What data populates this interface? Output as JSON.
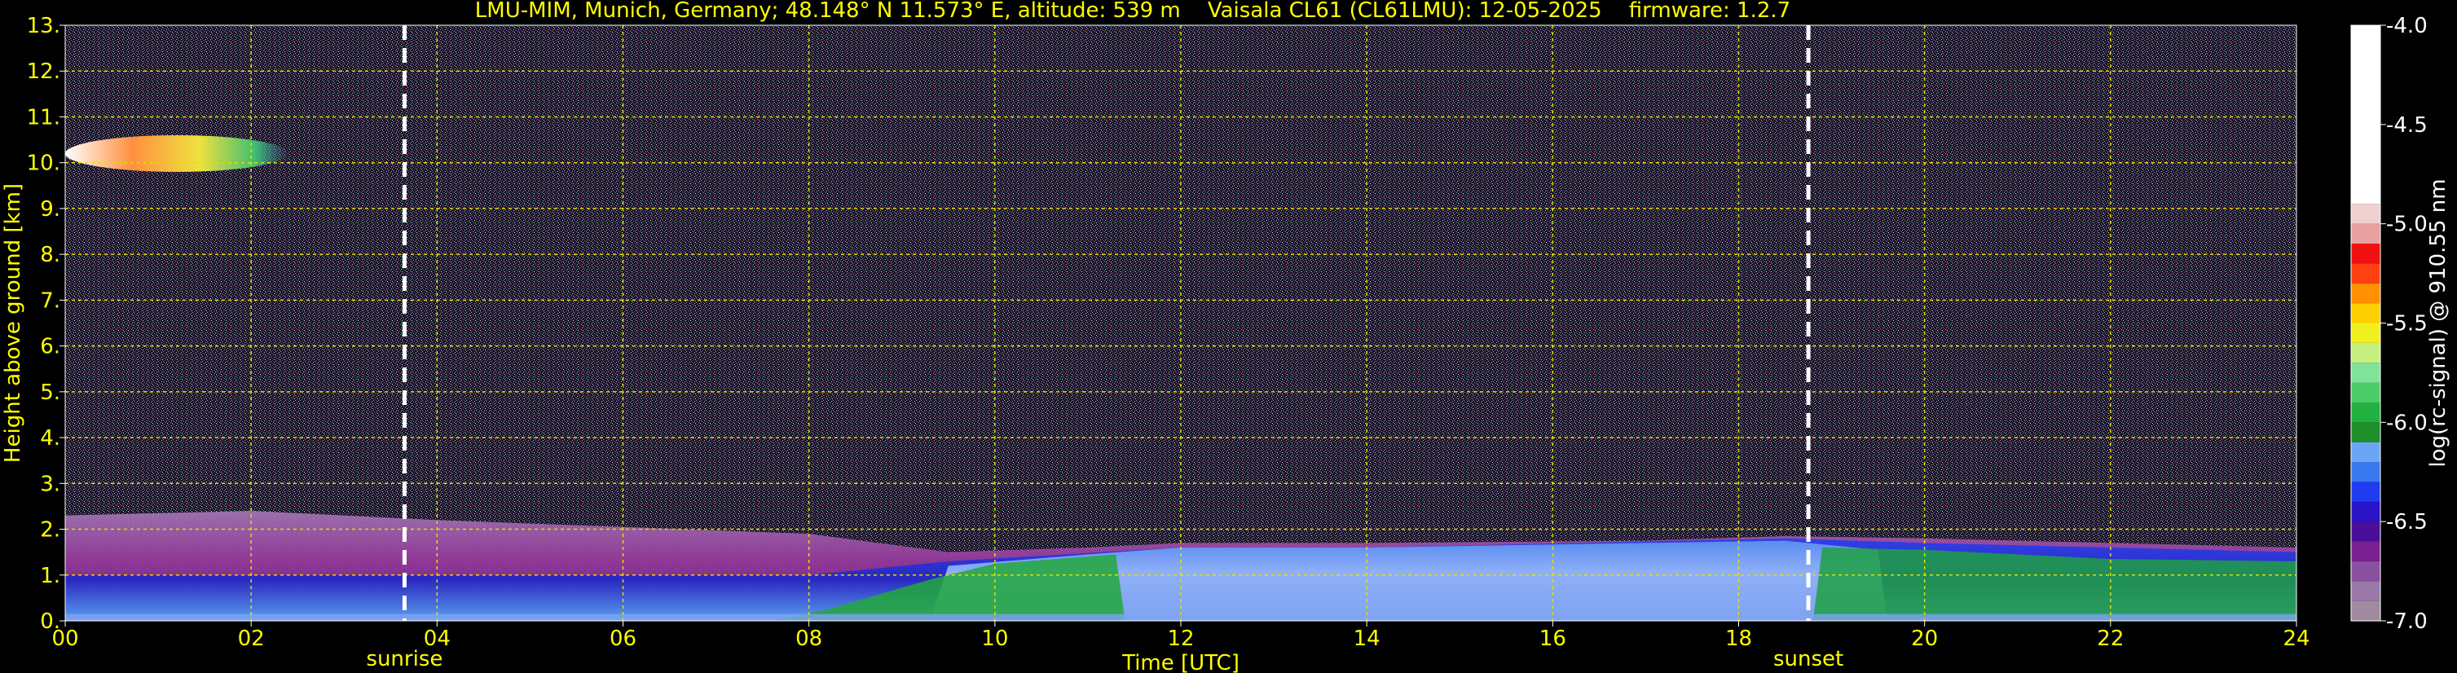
{
  "title": "LMU-MIM, Munich, Germany; 48.148° N 11.573° E, altitude: 539 m    Vaisala CL61 (CL61LMU): 12-05-2025    firmware: 1.2.7",
  "colors": {
    "background": "#000000",
    "text": "#ffff00",
    "grid": "#e0e000",
    "sun_marker": "#ffffff",
    "colorbar_label": "#ffffff"
  },
  "chart_data": {
    "type": "heatmap",
    "title": "LMU-MIM, Munich, Germany; 48.148° N 11.573° E, altitude: 539 m    Vaisala CL61 (CL61LMU): 12-05-2025    firmware: 1.2.7",
    "xlabel": "Time [UTC]",
    "ylabel": "Height above ground [km]",
    "xlim": [
      0,
      24
    ],
    "ylim": [
      0,
      13
    ],
    "xticks": [
      0,
      2,
      4,
      6,
      8,
      10,
      12,
      14,
      16,
      18,
      20,
      22,
      24
    ],
    "xtick_labels": [
      "00",
      "02",
      "04",
      "06",
      "08",
      "10",
      "12",
      "14",
      "16",
      "18",
      "20",
      "22",
      "24"
    ],
    "yticks": [
      0,
      1,
      2,
      3,
      4,
      5,
      6,
      7,
      8,
      9,
      10,
      11,
      12,
      13
    ],
    "ytick_labels": [
      "0.",
      "1.",
      "2.",
      "3.",
      "4.",
      "5.",
      "6.",
      "7.",
      "8.",
      "9.",
      "10.",
      "11.",
      "12.",
      "13."
    ],
    "grid": true,
    "sun_events": [
      {
        "label": "sunrise",
        "time": 3.65
      },
      {
        "label": "sunset",
        "time": 18.75
      }
    ],
    "colorbar": {
      "label": "log(rc-signal) @ 910.55 nm",
      "range": [
        -7.0,
        -4.0
      ],
      "ticks": [
        -7.0,
        -6.5,
        -6.0,
        -5.5,
        -5.0,
        -4.5,
        -4.0
      ],
      "tick_labels": [
        "-7.0",
        "-6.5",
        "-6.0",
        "-5.5",
        "-5.0",
        "-4.5",
        "-4.0"
      ],
      "colors": [
        "#a08aa0",
        "#9a78a8",
        "#8a4fa0",
        "#7a2090",
        "#4a0f9a",
        "#2a14c8",
        "#1f3cf0",
        "#3a78f0",
        "#6aa6f5",
        "#1e8f2a",
        "#22b040",
        "#4ccc6a",
        "#7fe39a",
        "#c8f080",
        "#f0f020",
        "#ffd000",
        "#ff9000",
        "#ff4010",
        "#f01010",
        "#e8a0a0",
        "#f0d0d0",
        "#ffffff"
      ],
      "color_bounds": [
        -7.0,
        -6.9,
        -6.8,
        -6.7,
        -6.6,
        -6.5,
        -6.4,
        -6.3,
        -6.2,
        -6.1,
        -6.0,
        -5.9,
        -5.8,
        -5.7,
        -5.6,
        -5.5,
        -5.4,
        -5.3,
        -5.2,
        -5.1,
        -5.0,
        -4.9,
        -4.0
      ]
    },
    "features": {
      "boundary_layer_top_km": [
        {
          "t": 0.0,
          "h": 2.3
        },
        {
          "t": 2.0,
          "h": 2.4
        },
        {
          "t": 4.0,
          "h": 2.2
        },
        {
          "t": 8.0,
          "h": 1.9
        },
        {
          "t": 9.5,
          "h": 1.5
        },
        {
          "t": 11.0,
          "h": 1.6
        },
        {
          "t": 12.0,
          "h": 1.7
        },
        {
          "t": 14.0,
          "h": 1.7
        },
        {
          "t": 17.0,
          "h": 1.75
        },
        {
          "t": 18.5,
          "h": 1.85
        },
        {
          "t": 20.0,
          "h": 1.8
        },
        {
          "t": 22.0,
          "h": 1.7
        },
        {
          "t": 24.0,
          "h": 1.6
        }
      ],
      "aerosol_layer_top_km": [
        {
          "t": 0.0,
          "h": 1.0
        },
        {
          "t": 4.0,
          "h": 1.0
        },
        {
          "t": 8.0,
          "h": 1.0
        },
        {
          "t": 9.5,
          "h": 1.3
        },
        {
          "t": 12.0,
          "h": 1.6
        },
        {
          "t": 14.0,
          "h": 1.6
        },
        {
          "t": 18.5,
          "h": 1.8
        },
        {
          "t": 20.0,
          "h": 1.7
        },
        {
          "t": 24.0,
          "h": 1.5
        }
      ],
      "cirrus_cloud": {
        "t_start": 0.0,
        "t_end": 2.4,
        "h_bottom_km": 9.8,
        "h_top_km": 10.6
      }
    }
  }
}
